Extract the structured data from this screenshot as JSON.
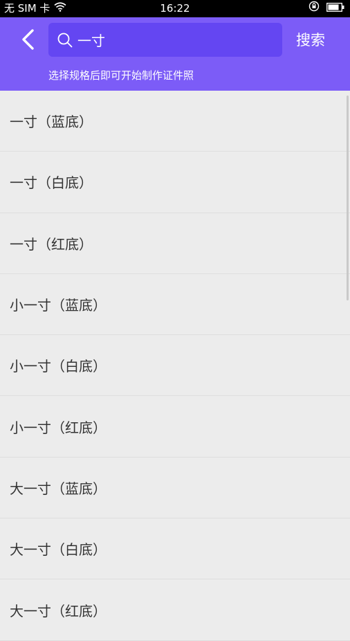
{
  "status_bar": {
    "carrier": "无 SIM 卡",
    "time": "16:22"
  },
  "header": {
    "search_value": "一寸",
    "search_button": "搜索",
    "hint": "选择规格后即可开始制作证件照"
  },
  "items": [
    {
      "label": "一寸（蓝底）"
    },
    {
      "label": "一寸（白底）"
    },
    {
      "label": "一寸（红底）"
    },
    {
      "label": "小一寸（蓝底）"
    },
    {
      "label": "小一寸（白底）"
    },
    {
      "label": "小一寸（红底）"
    },
    {
      "label": "大一寸（蓝底）"
    },
    {
      "label": "大一寸（白底）"
    },
    {
      "label": "大一寸（红底）"
    }
  ],
  "colors": {
    "header": "#7c5cf7",
    "search_box": "#6446f2",
    "background": "#ececec"
  }
}
